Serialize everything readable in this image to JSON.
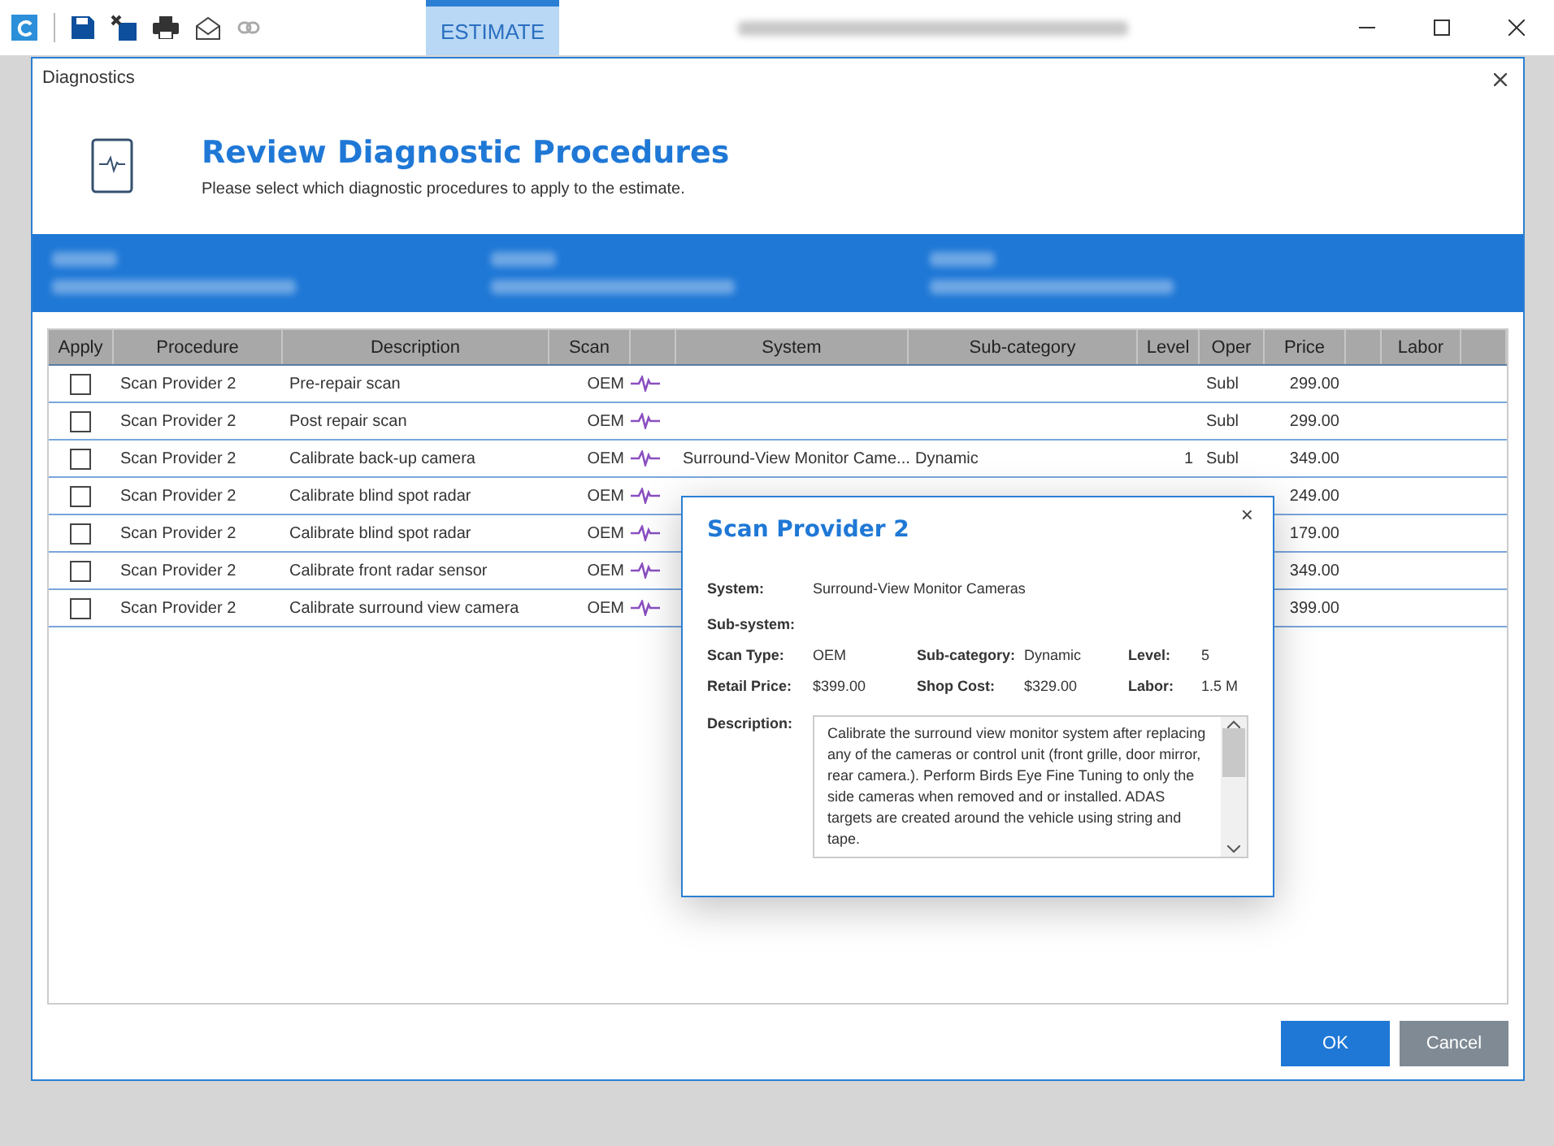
{
  "app": {
    "tab": {
      "label": "ESTIMATE",
      "selected": true
    }
  },
  "dialog": {
    "title": "Diagnostics",
    "heading": "Review Diagnostic Procedures",
    "subtitle": "Please select which diagnostic procedures to apply to the estimate.",
    "columns": [
      "Apply",
      "Procedure",
      "Description",
      "Scan",
      "",
      "System",
      "Sub-category",
      "Level",
      "Oper",
      "Price",
      "",
      "Labor",
      ""
    ],
    "rows": [
      {
        "checked": false,
        "procedure": "Scan Provider 2",
        "description": "Pre-repair scan",
        "scan": "OEM",
        "oper": "Subl",
        "price": "299.00"
      },
      {
        "checked": false,
        "procedure": "Scan Provider 2",
        "description": "Post repair scan",
        "scan": "OEM",
        "oper": "Subl",
        "price": "299.00"
      },
      {
        "checked": false,
        "procedure": "Scan Provider 2",
        "description": "Calibrate back-up camera",
        "scan": "OEM",
        "system": "Surround-View Monitor Came...",
        "subcategory": "Dynamic",
        "level": "1",
        "oper": "Subl",
        "price": "349.00"
      },
      {
        "checked": false,
        "procedure": "Scan Provider 2",
        "description": "Calibrate blind spot radar",
        "scan": "OEM",
        "price": "249.00"
      },
      {
        "checked": false,
        "procedure": "Scan Provider 2",
        "description": "Calibrate blind spot radar",
        "scan": "OEM",
        "price": "179.00"
      },
      {
        "checked": false,
        "procedure": "Scan Provider 2",
        "description": "Calibrate front radar sensor",
        "scan": "OEM",
        "price": "349.00"
      },
      {
        "checked": false,
        "procedure": "Scan Provider 2",
        "description": "Calibrate surround view camera",
        "scan": "OEM",
        "price": "399.00"
      }
    ],
    "buttons": [
      {
        "label": "OK",
        "kind": "primary"
      },
      {
        "label": "Cancel",
        "kind": "secondary"
      }
    ]
  },
  "popup": {
    "title": "Scan Provider 2",
    "close": "×",
    "system_label": "System:",
    "system": "Surround-View Monitor Cameras",
    "subsystem_label": "Sub-system:",
    "fields": [
      {
        "label": "Scan Type:",
        "value": "OEM"
      },
      {
        "label": "Sub-category:",
        "value": "Dynamic"
      },
      {
        "label": "Level:",
        "value": "5"
      },
      {
        "label": "Retail Price:",
        "value": "$399.00"
      },
      {
        "label": "Shop Cost:",
        "value": "$329.00"
      },
      {
        "label": "Labor:",
        "value": "1.5 M"
      }
    ],
    "description_label": "Description:",
    "description": "Calibrate the surround view monitor system after replacing any of the cameras or control unit (front grille, door mirror, rear camera.). Perform Birds Eye Fine Tuning to only the side cameras when removed and or installed. ADAS targets are created around the vehicle using string and tape."
  }
}
